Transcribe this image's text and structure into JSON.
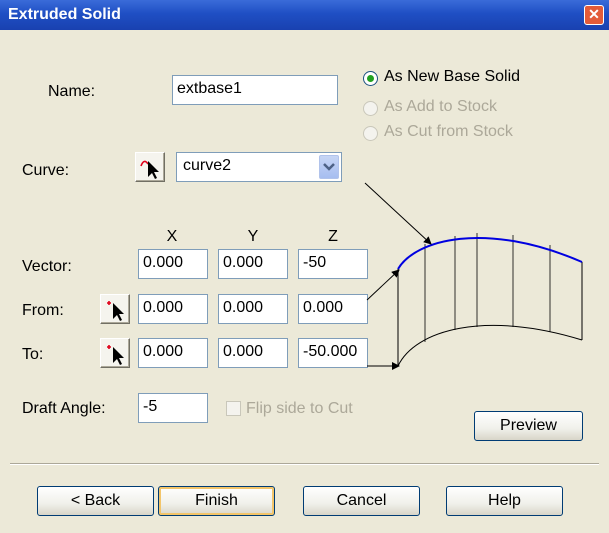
{
  "window": {
    "title": "Extruded Solid",
    "close_glyph": "✕"
  },
  "name": {
    "label": "Name:",
    "value": "extbase1"
  },
  "options": [
    {
      "label": "As New Base Solid",
      "selected": true,
      "enabled": true
    },
    {
      "label": "As Add to Stock",
      "selected": false,
      "enabled": false
    },
    {
      "label": "As Cut from Stock",
      "selected": false,
      "enabled": false
    }
  ],
  "curve": {
    "label": "Curve:",
    "value": "curve2"
  },
  "columns": {
    "x": "X",
    "y": "Y",
    "z": "Z"
  },
  "vector": {
    "label": "Vector:",
    "x": "0.000",
    "y": "0.000",
    "z": "-50"
  },
  "from": {
    "label": "From:",
    "x": "0.000",
    "y": "0.000",
    "z": "0.000"
  },
  "to": {
    "label": "To:",
    "x": "0.000",
    "y": "0.000",
    "z": "-50.000"
  },
  "draft": {
    "label": "Draft Angle:",
    "value": "-5"
  },
  "flip": {
    "label": "Flip side to Cut",
    "checked": false,
    "enabled": false
  },
  "buttons": {
    "preview": "Preview",
    "back": "< Back",
    "finish": "Finish",
    "cancel": "Cancel",
    "help": "Help"
  },
  "colors": {
    "title_bar": "#2456CF",
    "dialog_bg": "#ECE9D8",
    "curve_blue": "#0000E0"
  },
  "icons": {
    "pick": "pick-cursor-icon",
    "dropdown": "chevron-down-icon",
    "close": "close-icon"
  }
}
